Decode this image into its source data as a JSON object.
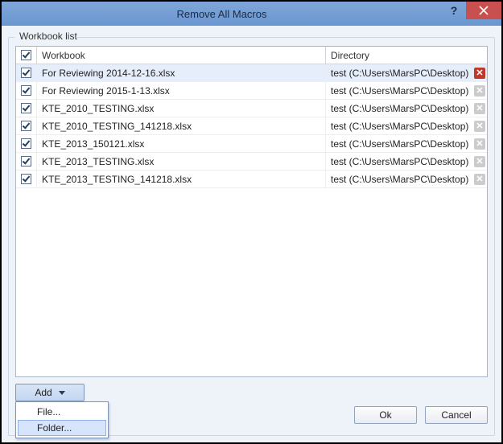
{
  "window": {
    "title": "Remove All Macros"
  },
  "group": {
    "label": "Workbook list"
  },
  "columns": {
    "workbook": "Workbook",
    "directory": "Directory"
  },
  "rows": [
    {
      "checked": true,
      "workbook": "For Reviewing 2014-12-16.xlsx",
      "directory": "test (C:\\Users\\MarsPC\\Desktop)",
      "selected": true,
      "canDelete": true
    },
    {
      "checked": true,
      "workbook": "For Reviewing 2015-1-13.xlsx",
      "directory": "test (C:\\Users\\MarsPC\\Desktop)",
      "selected": false,
      "canDelete": false
    },
    {
      "checked": true,
      "workbook": "KTE_2010_TESTING.xlsx",
      "directory": "test (C:\\Users\\MarsPC\\Desktop)",
      "selected": false,
      "canDelete": false
    },
    {
      "checked": true,
      "workbook": "KTE_2010_TESTING_141218.xlsx",
      "directory": "test (C:\\Users\\MarsPC\\Desktop)",
      "selected": false,
      "canDelete": false
    },
    {
      "checked": true,
      "workbook": "KTE_2013_150121.xlsx",
      "directory": "test (C:\\Users\\MarsPC\\Desktop)",
      "selected": false,
      "canDelete": false
    },
    {
      "checked": true,
      "workbook": "KTE_2013_TESTING.xlsx",
      "directory": "test (C:\\Users\\MarsPC\\Desktop)",
      "selected": false,
      "canDelete": false
    },
    {
      "checked": true,
      "workbook": "KTE_2013_TESTING_141218.xlsx",
      "directory": "test (C:\\Users\\MarsPC\\Desktop)",
      "selected": false,
      "canDelete": false
    }
  ],
  "headerChecked": true,
  "addButton": {
    "label": "Add",
    "menu": {
      "file": "File...",
      "folder": "Folder..."
    }
  },
  "footer": {
    "ok": "Ok",
    "cancel": "Cancel"
  }
}
